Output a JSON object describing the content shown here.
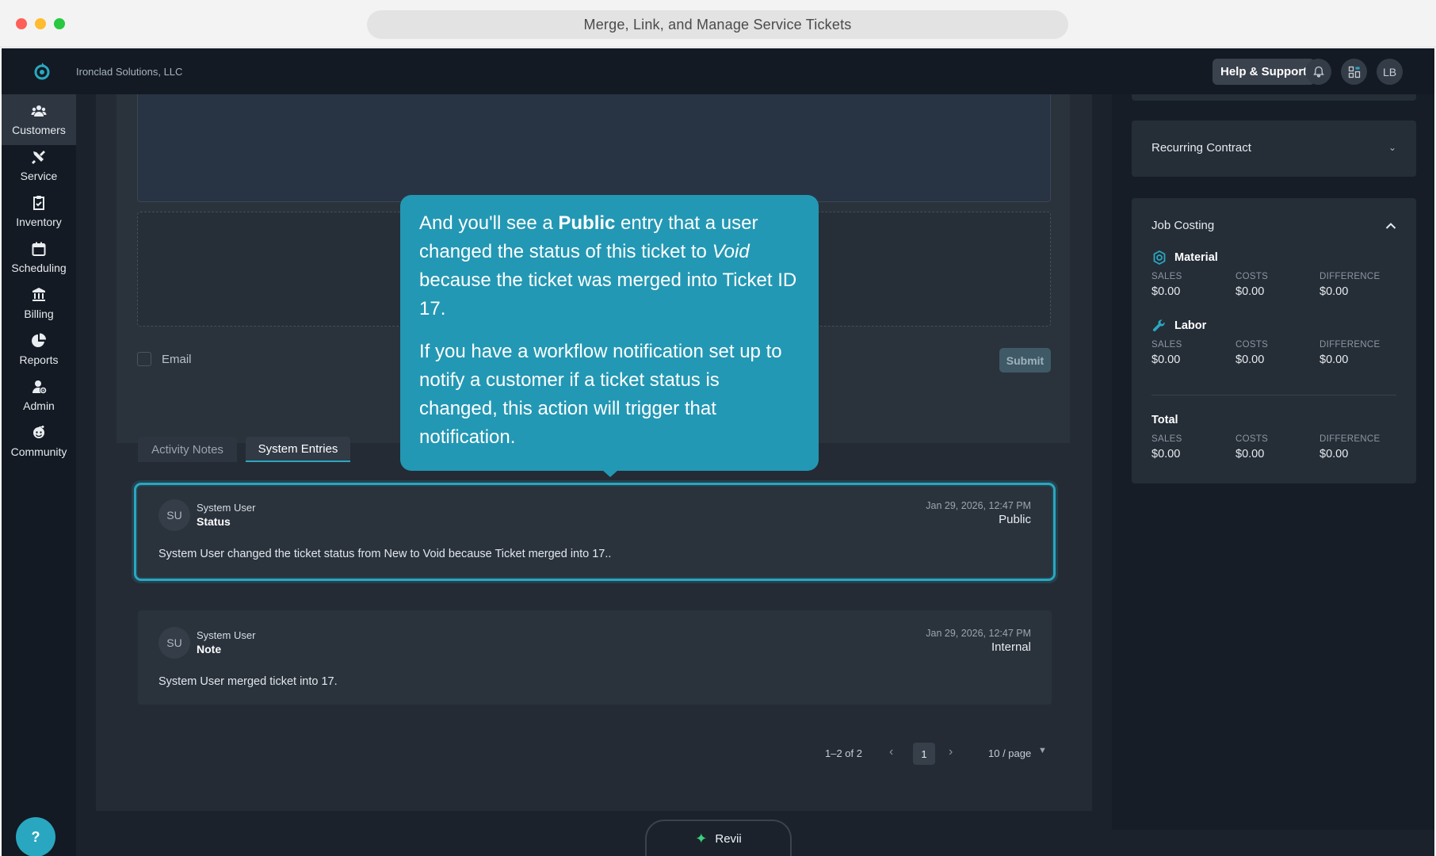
{
  "window": {
    "title": "Merge, Link, and Manage Service Tickets"
  },
  "topnav": {
    "company": "Ironclad Solutions, LLC",
    "help_label": "Help & Support",
    "avatar_initials": "LB"
  },
  "sidebar": {
    "items": [
      {
        "label": "Customers",
        "icon": "customers-icon",
        "active": true
      },
      {
        "label": "Service",
        "icon": "service-icon"
      },
      {
        "label": "Inventory",
        "icon": "inventory-icon"
      },
      {
        "label": "Scheduling",
        "icon": "calendar-icon"
      },
      {
        "label": "Billing",
        "icon": "bank-icon"
      },
      {
        "label": "Reports",
        "icon": "pie-chart-icon"
      },
      {
        "label": "Admin",
        "icon": "admin-icon"
      },
      {
        "label": "Community",
        "icon": "community-icon"
      }
    ],
    "help_fab": "?"
  },
  "composer": {
    "email_label": "Email",
    "submit_label": "Submit"
  },
  "tabs": {
    "activity_notes": "Activity Notes",
    "system_entries": "System Entries"
  },
  "entries": [
    {
      "initials": "SU",
      "user": "System User",
      "type": "Status",
      "date": "Jan 29, 2026, 12:47 PM",
      "visibility": "Public",
      "message": "System User changed the ticket status from New to Void because Ticket merged into 17.."
    },
    {
      "initials": "SU",
      "user": "System User",
      "type": "Note",
      "date": "Jan 29, 2026, 12:47 PM",
      "visibility": "Internal",
      "message": "System User merged ticket into 17."
    }
  ],
  "pagination": {
    "range": "1–2 of 2",
    "current_page": "1",
    "page_size": "10 / page"
  },
  "revii": {
    "label": "Revii"
  },
  "right": {
    "recurring_contract": "Recurring Contract",
    "job_costing": {
      "title": "Job Costing",
      "col_sales": "SALES",
      "col_costs": "COSTS",
      "col_difference": "DIFFERENCE",
      "material": {
        "title": "Material",
        "sales": "$0.00",
        "costs": "$0.00",
        "difference": "$0.00"
      },
      "labor": {
        "title": "Labor",
        "sales": "$0.00",
        "costs": "$0.00",
        "difference": "$0.00"
      },
      "total": {
        "title": "Total",
        "sales": "$0.00",
        "costs": "$0.00",
        "difference": "$0.00"
      }
    }
  },
  "tooltip": {
    "p1_a": "And you'll see a ",
    "p1_bold": "Public",
    "p1_b": " entry that a user changed the status of this ticket to ",
    "p1_italic": "Void",
    "p1_c": " because the ticket was merged into Ticket ID 17.",
    "p2": "If you have a workflow notification set up to notify a customer if a ticket status is changed, this action will trigger that notification."
  },
  "colors": {
    "accent": "#2aa7c0",
    "tooltip_bg": "#2398b4",
    "app_bg": "#1b222c",
    "nav_bg": "#131a23"
  }
}
